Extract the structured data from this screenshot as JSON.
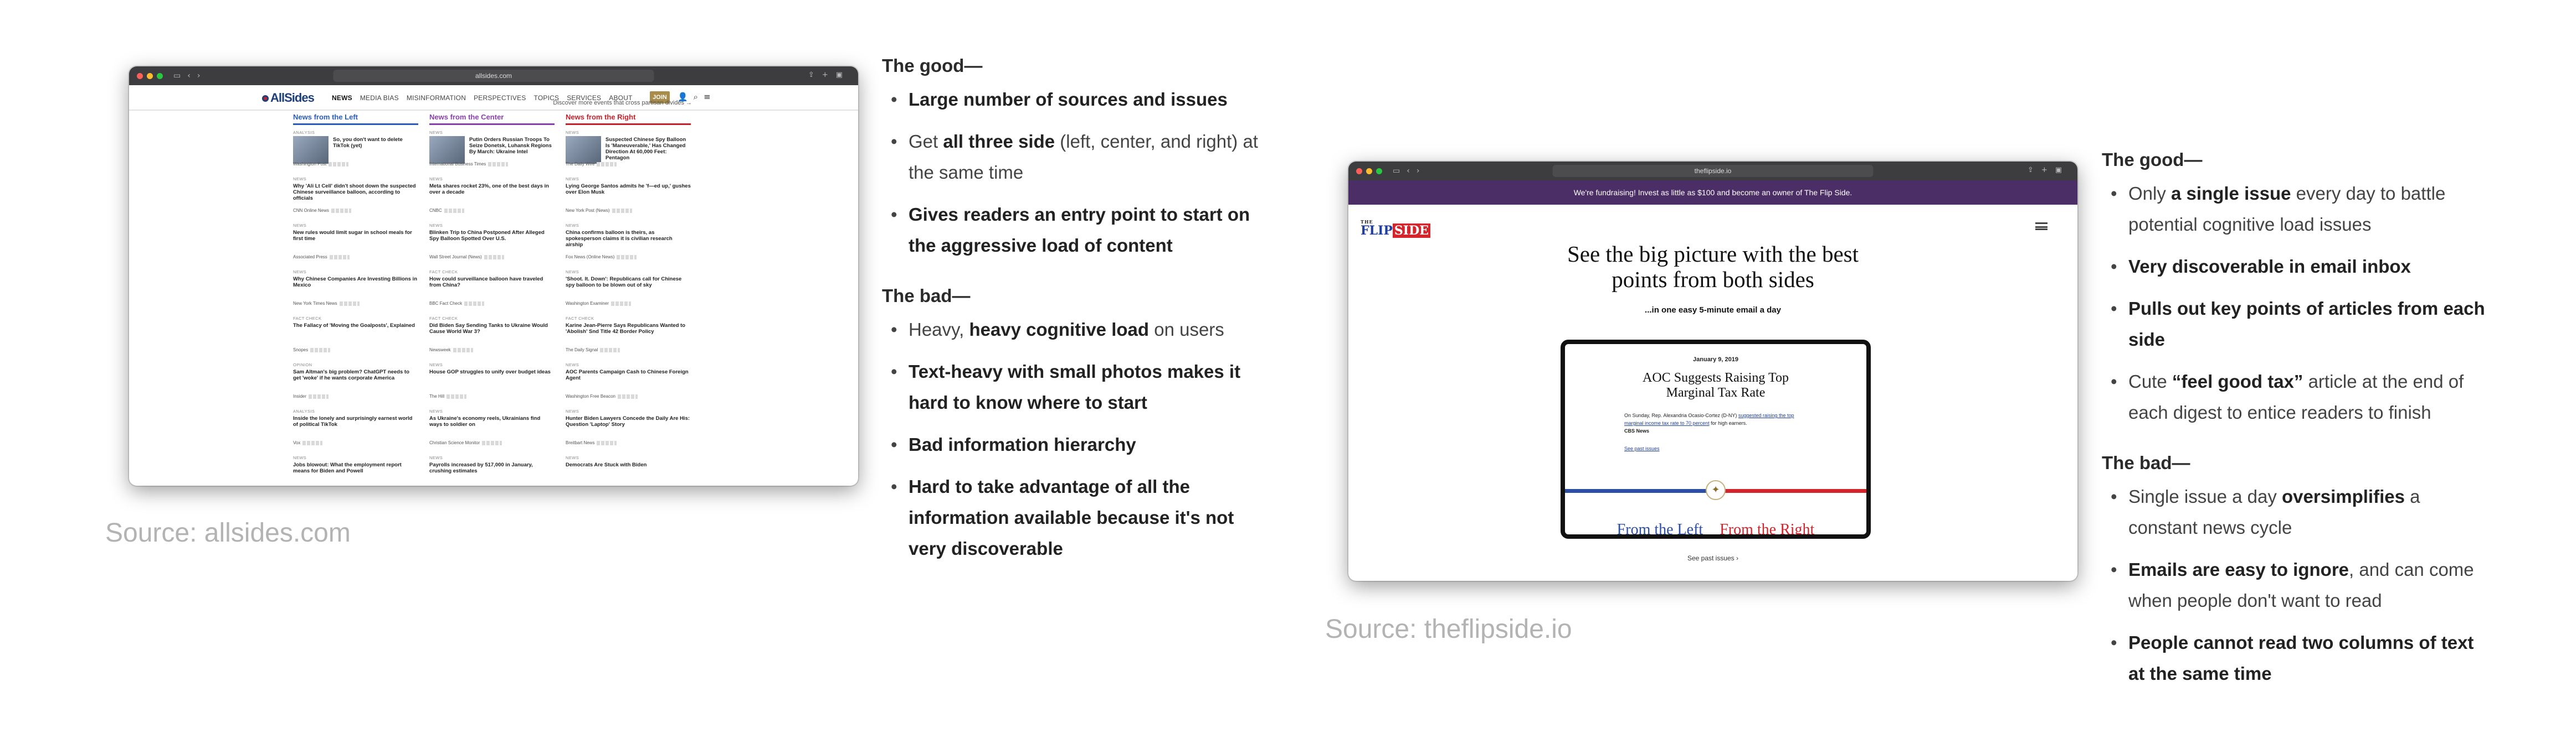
{
  "allsides": {
    "browser": {
      "url": "allsides.com"
    },
    "nav": {
      "logo": "AllSides",
      "items": [
        "NEWS",
        "MEDIA BIAS",
        "MISINFORMATION",
        "PERSPECTIVES",
        "TOPICS",
        "SERVICES",
        "ABOUT"
      ],
      "join": "JOIN"
    },
    "promo": "Discover more events that cross partisan divides →",
    "columns": [
      {
        "title": "News from the Left",
        "color": "#2a5bbf",
        "items": [
          {
            "tag": "ANALYSIS",
            "headline": "So, you don't want to delete TikTok (yet)",
            "source": "Washington Post",
            "pic": true
          },
          {
            "tag": "NEWS",
            "headline": "Why 'Ali Lt Cell' didn't shoot down the suspected Chinese surveillance balloon, according to officials",
            "source": "CNN Online News"
          },
          {
            "tag": "NEWS",
            "headline": "New rules would limit sugar in school meals for first time",
            "source": "Associated Press"
          },
          {
            "tag": "NEWS",
            "headline": "Why Chinese Companies Are Investing Billions in Mexico",
            "source": "New York Times News"
          },
          {
            "tag": "FACT CHECK",
            "headline": "The Fallacy of 'Moving the Goalposts', Explained",
            "source": "Snopes"
          },
          {
            "tag": "OPINION",
            "headline": "Sam Altman's big problem? ChatGPT needs to get 'woke' if he wants corporate America",
            "source": "Insider"
          },
          {
            "tag": "ANALYSIS",
            "headline": "Inside the lonely and surprisingly earnest world of political TikTok",
            "source": "Vox"
          },
          {
            "tag": "NEWS",
            "headline": "Jobs blowout: What the employment report means for Biden and Powell",
            "source": "Axios"
          }
        ]
      },
      {
        "title": "News from the Center",
        "color": "#8a3fb0",
        "items": [
          {
            "tag": "NEWS",
            "headline": "Putin Orders Russian Troops To Seize Donetsk, Luhansk Regions By March: Ukraine Intel",
            "source": "International Business Times",
            "pic": true
          },
          {
            "tag": "NEWS",
            "headline": "Meta shares rocket 23%, one of the best days in over a decade",
            "source": "CNBC"
          },
          {
            "tag": "NEWS",
            "headline": "Blinken Trip to China Postponed After Alleged Spy Balloon Spotted Over U.S.",
            "source": "Wall Street Journal (News)"
          },
          {
            "tag": "FACT CHECK",
            "headline": "How could surveillance balloon have traveled from China?",
            "source": "BBC Fact Check"
          },
          {
            "tag": "FACT CHECK",
            "headline": "Did Biden Say Sending Tanks to Ukraine Would Cause World War 3?",
            "source": "Newsweek"
          },
          {
            "tag": "NEWS",
            "headline": "House GOP struggles to unify over budget ideas",
            "source": "The Hill"
          },
          {
            "tag": "NEWS",
            "headline": "As Ukraine's economy reels, Ukrainians find ways to soldier on",
            "source": "Christian Science Monitor"
          },
          {
            "tag": "NEWS",
            "headline": "Payrolls increased by 517,000 in January, crushing estimates",
            "source": "CNBC"
          }
        ]
      },
      {
        "title": "News from the Right",
        "color": "#c8202b",
        "items": [
          {
            "tag": "NEWS",
            "headline": "Suspected Chinese Spy Balloon Is 'Maneuverable,' Has Changed Direction At 60,000 Feet: Pentagon",
            "source": "The Daily Wire",
            "pic": true
          },
          {
            "tag": "NEWS",
            "headline": "Lying George Santos admits he 'f—ed up,' gushes over Elon Musk",
            "source": "New York Post (News)"
          },
          {
            "tag": "NEWS",
            "headline": "China confirms balloon is theirs, as spokesperson claims it is civilian research airship",
            "source": "Fox News (Online News)"
          },
          {
            "tag": "NEWS",
            "headline": "'Shoot. It. Down': Republicans call for Chinese spy balloon to be blown out of sky",
            "source": "Washington Examiner"
          },
          {
            "tag": "FACT CHECK",
            "headline": "Karine Jean-Pierre Says Republicans Wanted to 'Abolish' Snd Title 42 Border Policy",
            "source": "The Daily Signal"
          },
          {
            "tag": "NEWS",
            "headline": "AOC Parents Campaign Cash to Chinese Foreign Agent",
            "source": "Washington Free Beacon"
          },
          {
            "tag": "NEWS",
            "headline": "Hunter Biden Lawyers Concede the Daily Are His: Question 'Laptop' Story",
            "source": "Breitbart News"
          },
          {
            "tag": "NEWS",
            "headline": "Democrats Are Stuck with Biden",
            "source": "National Review"
          }
        ]
      }
    ],
    "source_caption": "Source: allsides.com",
    "notes": {
      "good_title": "The good—",
      "good": [
        [
          "",
          "Large number of sources and issues",
          ""
        ],
        [
          "Get ",
          "all three side",
          " (left, center, and right) at the same time"
        ],
        [
          "",
          "Gives readers an entry point to start on the aggressive load of content",
          ""
        ]
      ],
      "bad_title": "The bad—",
      "bad": [
        [
          "Heavy, ",
          "heavy cognitive load",
          " on users"
        ],
        [
          "",
          "Text-heavy with small photos makes it hard to know where to start",
          ""
        ],
        [
          "",
          "Bad information hierarchy",
          ""
        ],
        [
          "",
          "Hard to take advantage of all the information available because it's not very discoverable",
          ""
        ]
      ]
    }
  },
  "flipside": {
    "browser": {
      "url": "theflipside.io"
    },
    "banner": "We're fundraising! Invest as little as $100 and become an owner of The Flip Side.",
    "logo": {
      "the": "THE",
      "flip": "FLIP",
      "side": "SIDE"
    },
    "headline": "See the big picture with the best points from both sides",
    "sub": "...in one easy 5-minute email a day",
    "email": {
      "date": "January 9, 2019",
      "title": "AOC Suggests Raising Top Marginal Tax Rate",
      "body_pre": "On Sunday, Rep. Alexandria Ocasio-Cortez (D-NY) ",
      "body_link": "suggested raising the top marginal income tax rate to 70 percent",
      "body_post": " for high earners.",
      "body_src": "CBS News",
      "past_link": "See past issues",
      "left": "From the Left",
      "right": "From the Right"
    },
    "see_past": "See past issues ›",
    "source_caption": "Source: theflipside.io",
    "notes": {
      "good_title": "The good—",
      "good": [
        [
          "Only ",
          "a single issue",
          " every day to battle potential cognitive load issues"
        ],
        [
          "",
          "Very discoverable in email inbox",
          ""
        ],
        [
          "",
          "Pulls out key points of articles from each side",
          ""
        ],
        [
          "Cute ",
          "“feel good tax”",
          " article at the end of each digest to entice readers to finish"
        ]
      ],
      "bad_title": "The bad—",
      "bad": [
        [
          "Single issue a day ",
          "oversimplifies",
          " a constant news cycle"
        ],
        [
          "",
          "Emails are easy to ignore",
          ", and can come when people don't want to read"
        ],
        [
          "",
          "People cannot read two columns of text at the same time",
          ""
        ]
      ]
    }
  }
}
